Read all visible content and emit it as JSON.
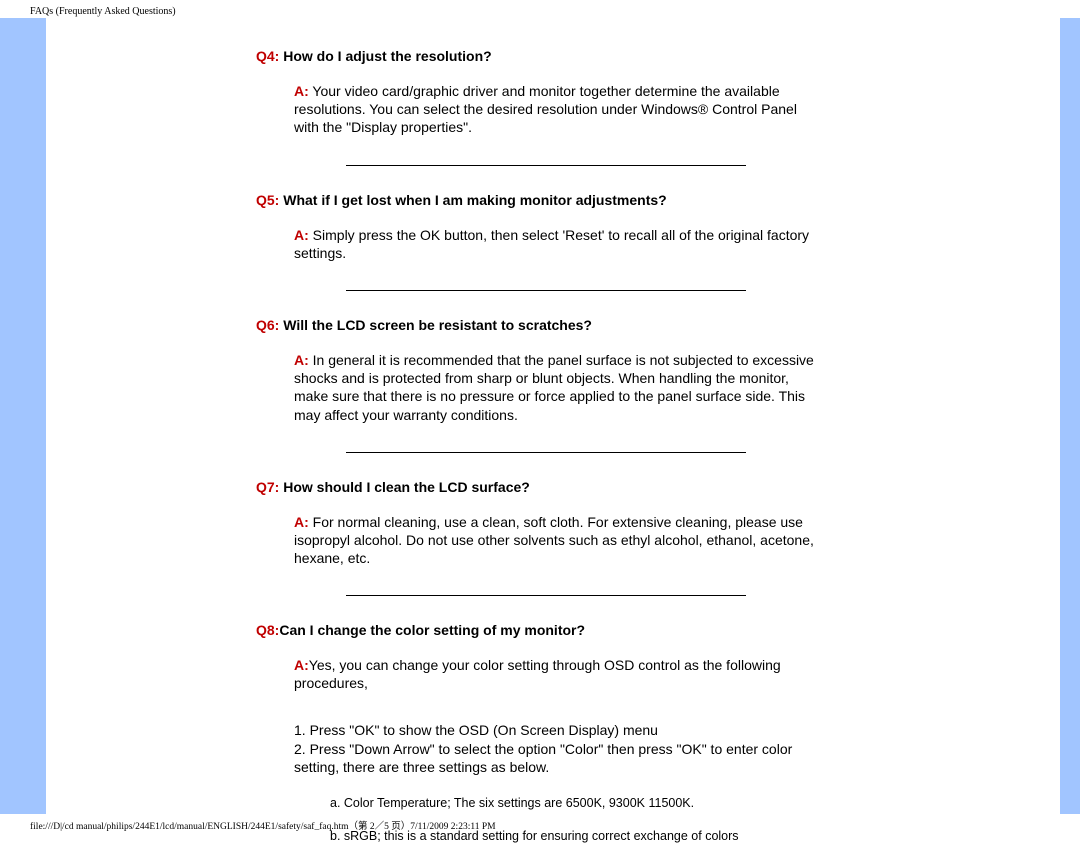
{
  "browser_title": "FAQs (Frequently Asked Questions)",
  "faq": [
    {
      "qlabel": "Q4:",
      "qtext": " How do I adjust the resolution?",
      "alabel": "A:",
      "atext": " Your video card/graphic driver and monitor together determine the available resolutions. You can select the desired resolution under Windows® Control Panel with the \"Display properties\"."
    },
    {
      "qlabel": "Q5:",
      "qtext": " What if I get lost when I am making monitor adjustments?",
      "alabel": "A:",
      "atext": " Simply press the OK button, then select 'Reset' to recall all of the original factory settings."
    },
    {
      "qlabel": "Q6:",
      "qtext": " Will the LCD screen be resistant to scratches?",
      "alabel": "A:",
      "atext": " In general it is recommended that the panel surface is not subjected to excessive shocks and is protected from sharp or blunt objects. When handling the monitor, make sure that there is no pressure or force applied to the panel surface side.  This may affect your warranty conditions."
    },
    {
      "qlabel": "Q7:",
      "qtext": " How should I clean the LCD surface?",
      "alabel": "A:",
      "atext": " For normal cleaning, use a clean, soft cloth. For extensive cleaning, please use isopropyl alcohol. Do not use other solvents such as ethyl alcohol, ethanol, acetone, hexane, etc."
    },
    {
      "qlabel": "Q8:",
      "qtext": "Can I change the color setting of my monitor?",
      "alabel": "A:",
      "atext": "Yes, you can change your color setting through OSD control as the following procedures,"
    }
  ],
  "steps": {
    "line1": "1. Press \"OK\" to show the OSD (On Screen Display) menu",
    "line2": "2. Press \"Down Arrow\" to select the option \"Color\" then press \"OK\" to enter color setting, there are three settings as below."
  },
  "sub": {
    "a": "a. Color Temperature; The six settings are   6500K, 9300K 11500K.",
    "b": "b. sRGB; this is a standard setting for ensuring correct exchange of colors"
  },
  "footer": "file:///D|/cd manual/philips/244E1/lcd/manual/ENGLISH/244E1/safety/saf_faq.htm（第 2／5 页）7/11/2009 2:23:11 PM"
}
